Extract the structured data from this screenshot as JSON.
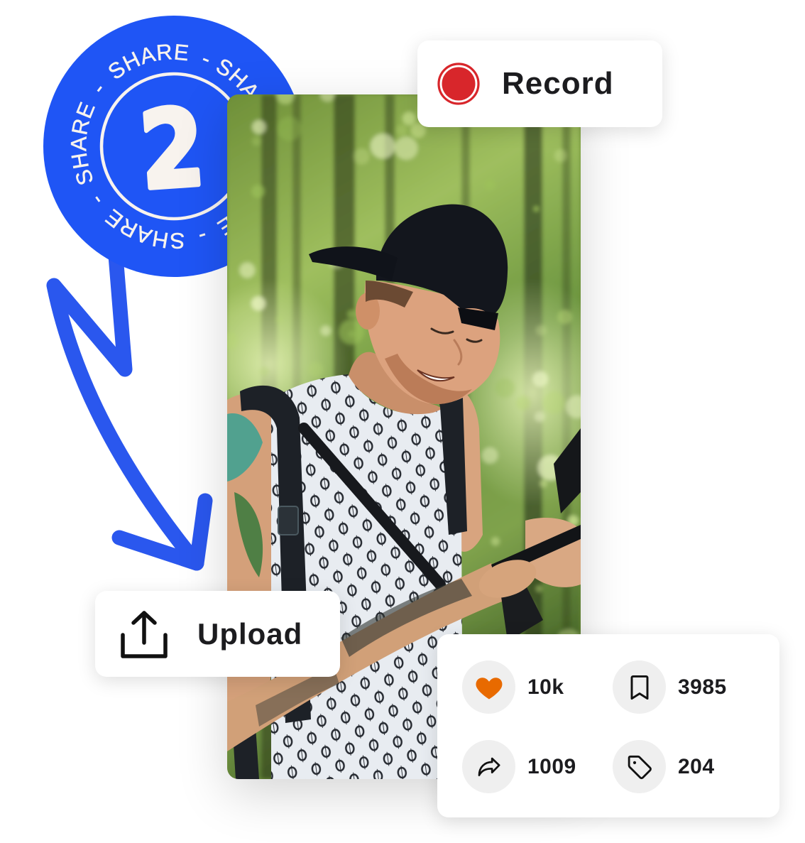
{
  "badge": {
    "ring_text": "SHARE - SHARE - SHARE - SHARE - SHARE -",
    "number": "2",
    "color": "#1f55f5",
    "text_color": "#f8f3ee"
  },
  "arrow": {
    "icon": "squiggle-arrow-icon",
    "color": "#2a57ee"
  },
  "record_button": {
    "label": "Record",
    "icon": "record-icon",
    "color": "#d8262b"
  },
  "upload_button": {
    "label": "Upload",
    "icon": "upload-icon"
  },
  "photo": {
    "description": "Smiling man in a black backwards cap and patterned tank top looking at a phone in a sunlit forest"
  },
  "stats": {
    "likes": {
      "icon": "heart-icon",
      "value": "10k",
      "color": "#e86a00"
    },
    "saves": {
      "icon": "bookmark-icon",
      "value": "3985"
    },
    "shares": {
      "icon": "share-icon",
      "value": "1009"
    },
    "tags": {
      "icon": "tag-icon",
      "value": "204"
    }
  }
}
